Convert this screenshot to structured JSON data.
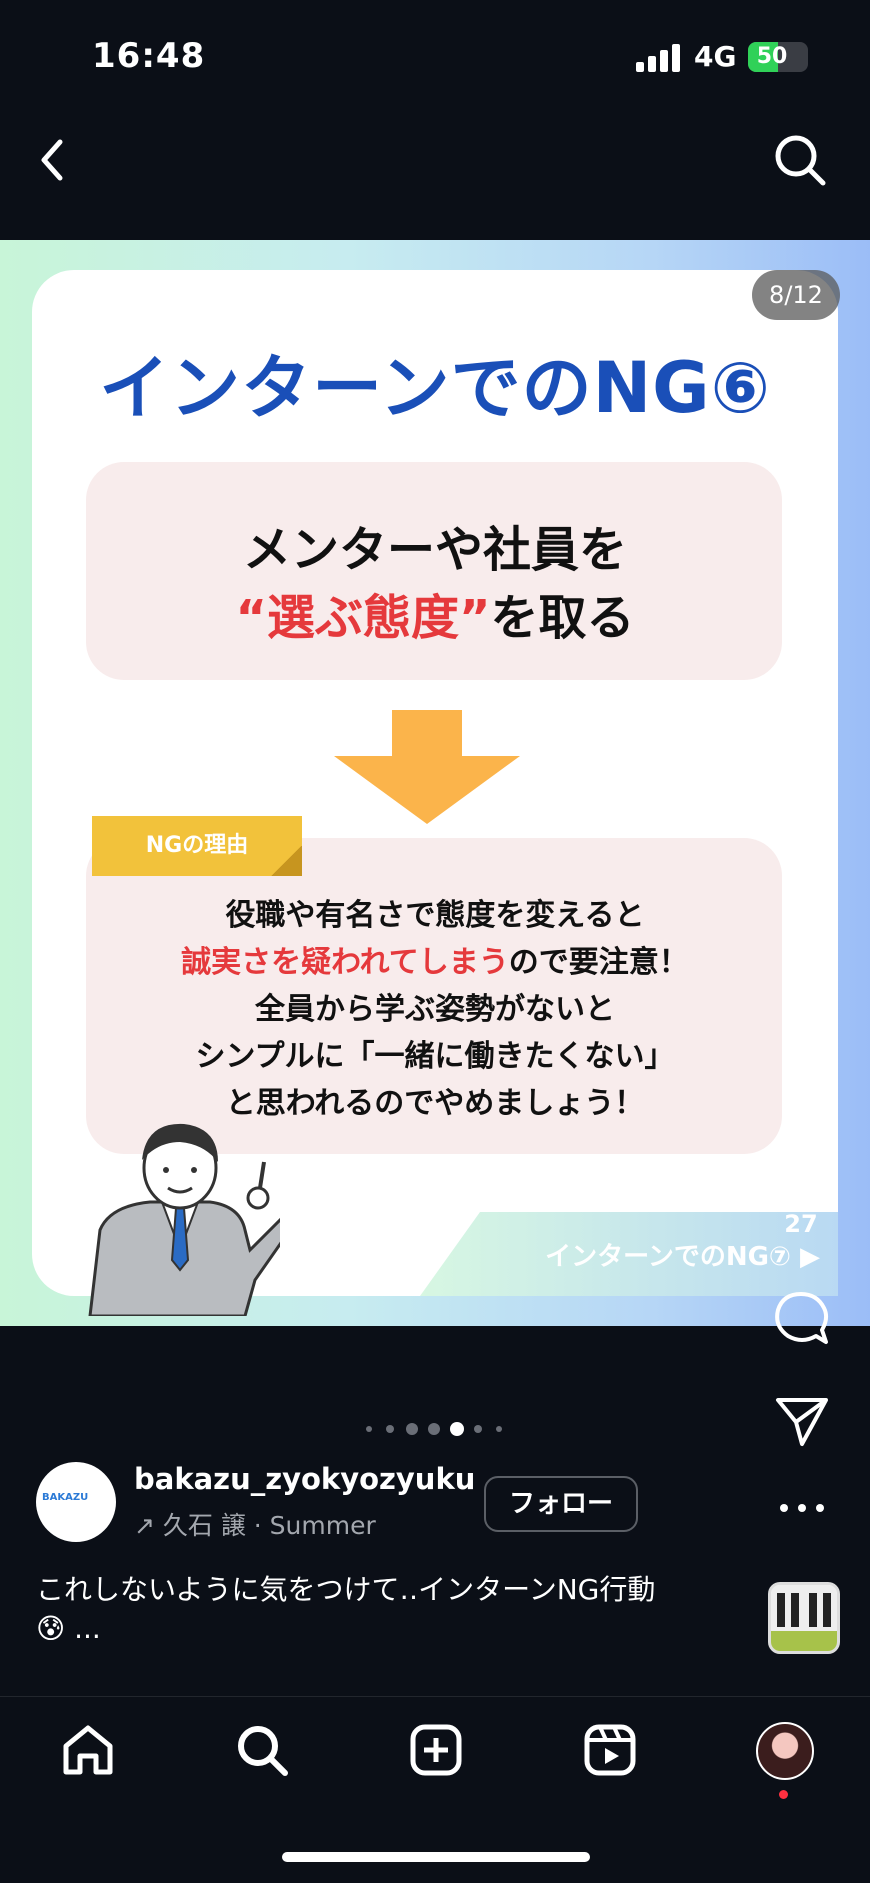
{
  "status_bar": {
    "time": "16:48",
    "network": "4G",
    "battery": "50",
    "battery_level": 0.5
  },
  "post": {
    "page_counter": "8/12",
    "slide": {
      "title": "インターンでのNG⑥",
      "headline_line1": "メンターや社員を",
      "headline_line2_highlight": "“選ぶ態度”",
      "headline_line2_rest": "を取る",
      "reason_tag": "NGの理由",
      "reason_line1": "役職や有名さで態度を変えると",
      "reason_line2_highlight": "誠実さを疑われてしまう",
      "reason_line2_rest": "ので要注意！",
      "reason_line3": "全員から学ぶ姿勢がないと",
      "reason_line4": "シンプルに「一緒に働きたくない」",
      "reason_line5": "と思われるのでやめましょう！",
      "next_link": "インターンでのNG⑦ ▶"
    },
    "like_count": "27",
    "author": {
      "avatar_text": "BAKAZU",
      "username": "bakazu_zyokyozyuku",
      "audio": "↗ 久石 譲 · Summer",
      "follow_label": "フォロー"
    },
    "caption_line1": "これしないように気をつけて‥インターンNG行動",
    "caption_line2_emoji": "😰",
    "caption_line2_more": " ..."
  },
  "icons": {
    "back": "chevron-left-icon",
    "search": "search-icon",
    "heart": "heart-icon",
    "comment": "comment-icon",
    "share": "send-icon",
    "more": "more-icon",
    "home": "home-icon",
    "explore": "search-icon",
    "create": "plus-square-icon",
    "reels": "reels-icon"
  },
  "colors": {
    "title_blue": "#1a4fb8",
    "highlight_red": "#e5393c",
    "tag_yellow": "#f2c23b",
    "arrow_orange": "#fbb44b",
    "notification_red": "#ff3040"
  }
}
